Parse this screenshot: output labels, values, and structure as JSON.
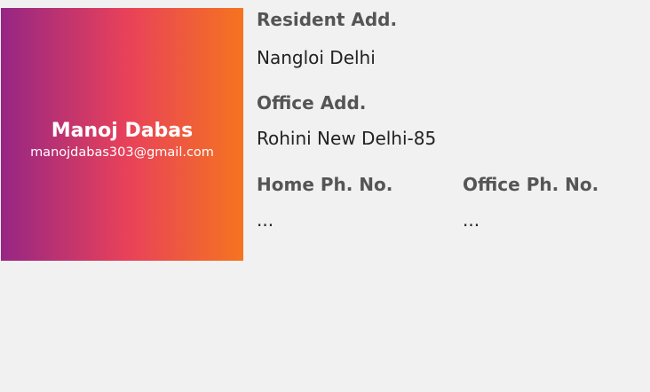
{
  "profile": {
    "name": "Manoj Dabas",
    "email": "manojdabas303@gmail.com"
  },
  "details": {
    "resident_label": "Resident Add.",
    "resident_value": "Nangloi Delhi",
    "office_label": "Office Add.",
    "office_value": "Rohini New Delhi-85",
    "home_phone_label": "Home Ph. No.",
    "home_phone_value": "...",
    "office_phone_label": "Office Ph. No.",
    "office_phone_value": "..."
  },
  "colors": {
    "gradient_start": "#962684",
    "gradient_mid": "#e8415a",
    "gradient_end": "#f5741f",
    "page_background": "#f1f1f1"
  }
}
